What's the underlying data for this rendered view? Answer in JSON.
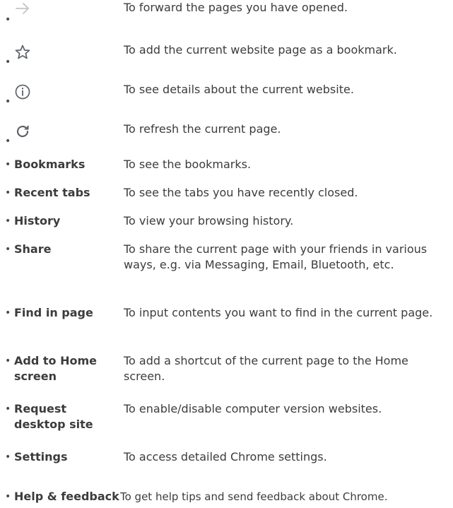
{
  "colors": {
    "text": "#3c3c3c",
    "icon_light": "#c4c4c4",
    "icon_dark": "#5f6368"
  },
  "rows": [
    {
      "icon": "forward-arrow-icon",
      "description": "To forward the pages you have opened."
    },
    {
      "icon": "star-icon",
      "description": "To add the current website page as a bookmark."
    },
    {
      "icon": "info-icon",
      "description": "To see details about the current website."
    },
    {
      "icon": "refresh-icon",
      "description": "To refresh the current page."
    },
    {
      "term": "Bookmarks",
      "description": "To see the bookmarks."
    },
    {
      "term": "Recent tabs",
      "description": "To see the tabs you have recently closed."
    },
    {
      "term": "History",
      "description": "To view your browsing history."
    },
    {
      "term": "Share",
      "description": "To share the current page with your friends in various ways, e.g. via Messaging, Email, Bluetooth, etc."
    },
    {
      "term": "Find in page",
      "description": "To input contents you want to find in the current page."
    },
    {
      "term": "Add to Home screen",
      "description": "To add a shortcut of the current page to the Home screen."
    },
    {
      "term": "Request desktop site",
      "description": "To enable/disable computer version websites."
    },
    {
      "term": "Settings",
      "description": "To access detailed Chrome settings."
    },
    {
      "term": "Help & feedback",
      "description": "To get help tips and send feedback about Chrome."
    }
  ]
}
